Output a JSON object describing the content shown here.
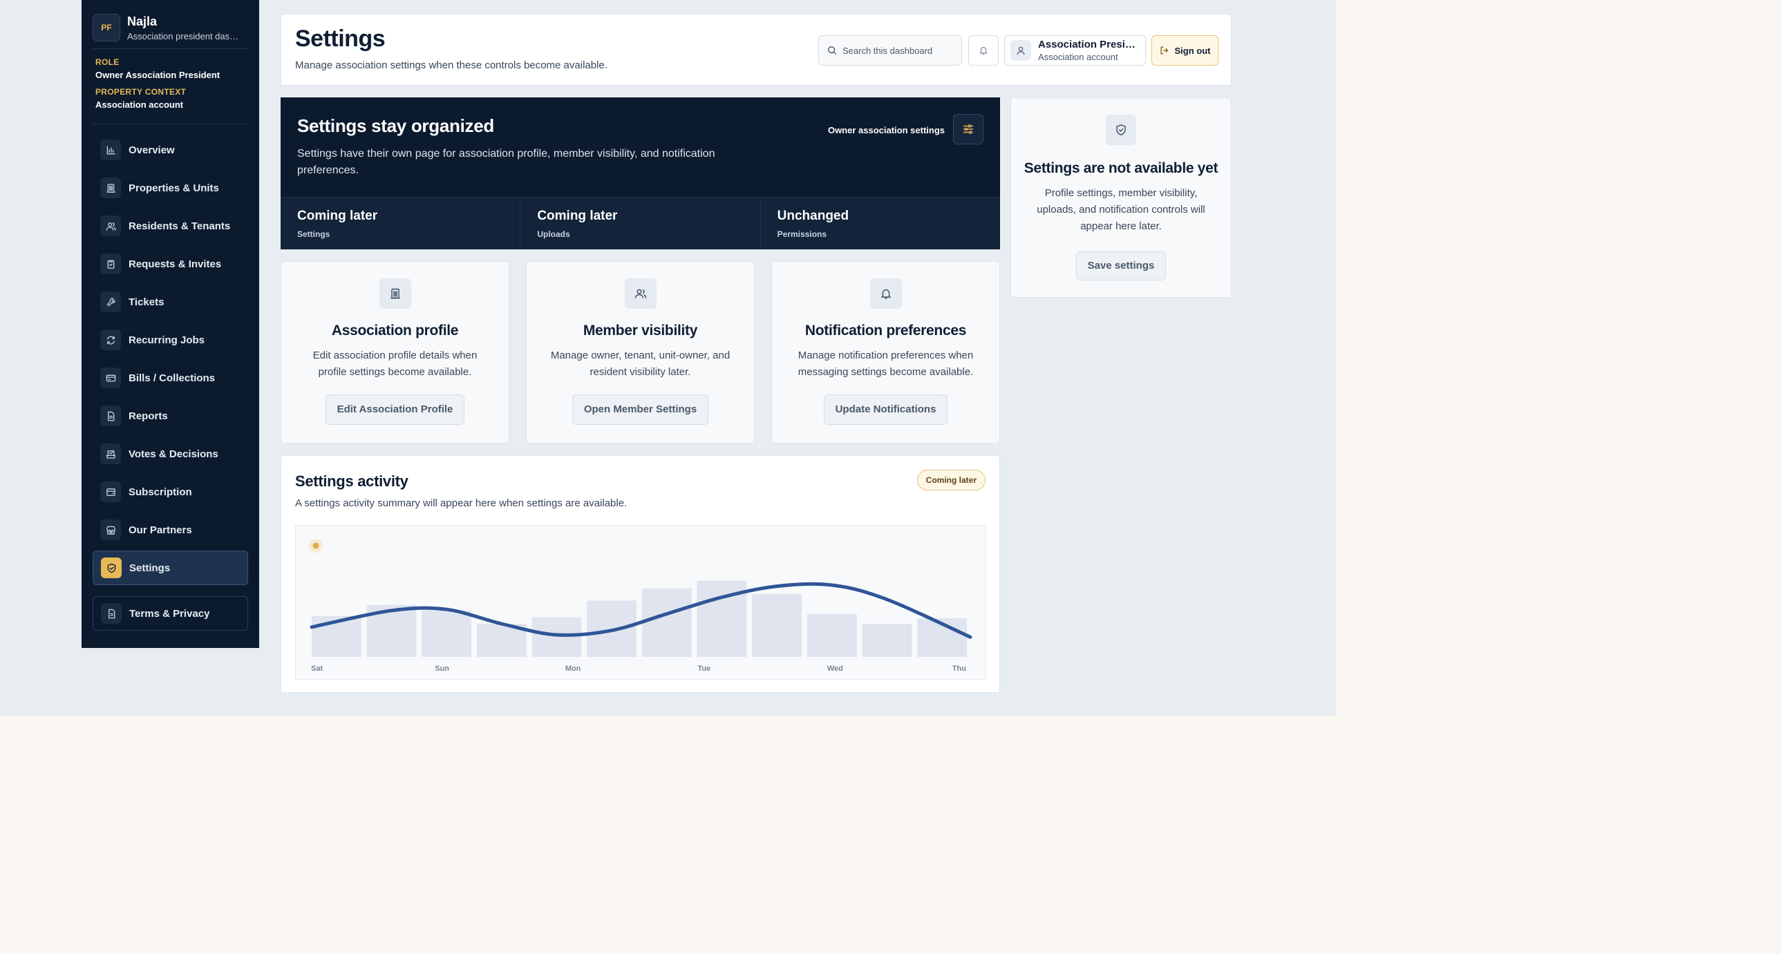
{
  "sidebar": {
    "brand_initials": "PF",
    "brand_name": "Najla",
    "brand_sub": "Association president dashboard",
    "role_label": "ROLE",
    "role_value": "Owner Association President",
    "context_label": "PROPERTY CONTEXT",
    "context_value": "Association account",
    "items": [
      {
        "label": "Overview",
        "icon": "chart-icon"
      },
      {
        "label": "Properties & Units",
        "icon": "building-icon"
      },
      {
        "label": "Residents & Tenants",
        "icon": "users-icon"
      },
      {
        "label": "Requests & Invites",
        "icon": "clipboard-icon"
      },
      {
        "label": "Tickets",
        "icon": "wrench-icon"
      },
      {
        "label": "Recurring Jobs",
        "icon": "repeat-icon"
      },
      {
        "label": "Bills / Collections",
        "icon": "card-icon"
      },
      {
        "label": "Reports",
        "icon": "document-icon"
      },
      {
        "label": "Votes & Decisions",
        "icon": "vote-icon"
      },
      {
        "label": "Subscription",
        "icon": "wallet-icon"
      },
      {
        "label": "Our Partners",
        "icon": "store-icon"
      },
      {
        "label": "Settings",
        "icon": "shield-icon"
      }
    ],
    "terms_label": "Terms & Privacy"
  },
  "header": {
    "title": "Settings",
    "subtitle": "Manage association settings when these controls become available.",
    "search_placeholder": "Search this dashboard",
    "account_name": "Association President",
    "account_sub": "Association account",
    "signout_label": "Sign out"
  },
  "hero": {
    "title": "Settings stay organized",
    "description": "Settings have their own page for association profile, member visibility, and notification preferences.",
    "tag": "Owner association settings",
    "stats": [
      {
        "value": "Coming later",
        "label": "Settings"
      },
      {
        "value": "Coming later",
        "label": "Uploads"
      },
      {
        "value": "Unchanged",
        "label": "Permissions"
      }
    ]
  },
  "cards": [
    {
      "title": "Association profile",
      "description": "Edit association profile details when profile settings become available.",
      "button": "Edit Association Profile",
      "icon": "building-icon"
    },
    {
      "title": "Member visibility",
      "description": "Manage owner, tenant, unit-owner, and resident visibility later.",
      "button": "Open Member Settings",
      "icon": "users-icon"
    },
    {
      "title": "Notification preferences",
      "description": "Manage notification preferences when messaging settings become available.",
      "button": "Update Notifications",
      "icon": "bell-icon"
    }
  ],
  "side": {
    "title": "Settings are not available yet",
    "description": "Profile settings, member visibility, uploads, and notification controls will appear here later.",
    "button": "Save settings"
  },
  "activity": {
    "title": "Settings activity",
    "subtitle": "A settings activity summary will appear here when settings are available.",
    "badge": "Coming later"
  },
  "chart_data": {
    "type": "bar",
    "x_labels": [
      "Sat",
      "Sun",
      "Mon",
      "Tue",
      "Wed",
      "Thu"
    ],
    "bar_values": [
      0.37,
      0.47,
      0.42,
      0.3,
      0.36,
      0.51,
      0.62,
      0.69,
      0.57,
      0.39,
      0.3,
      0.35
    ],
    "line_values": [
      0.27,
      0.42,
      0.43,
      0.3,
      0.2,
      0.24,
      0.39,
      0.54,
      0.64,
      0.65,
      0.52,
      0.18
    ],
    "colors": {
      "bar": "#dfe4ef",
      "line": "#2f5597",
      "marker": "#e0ad4d"
    }
  },
  "colors": {
    "accent": "#e7b857",
    "navy": "#0c1a2e"
  }
}
